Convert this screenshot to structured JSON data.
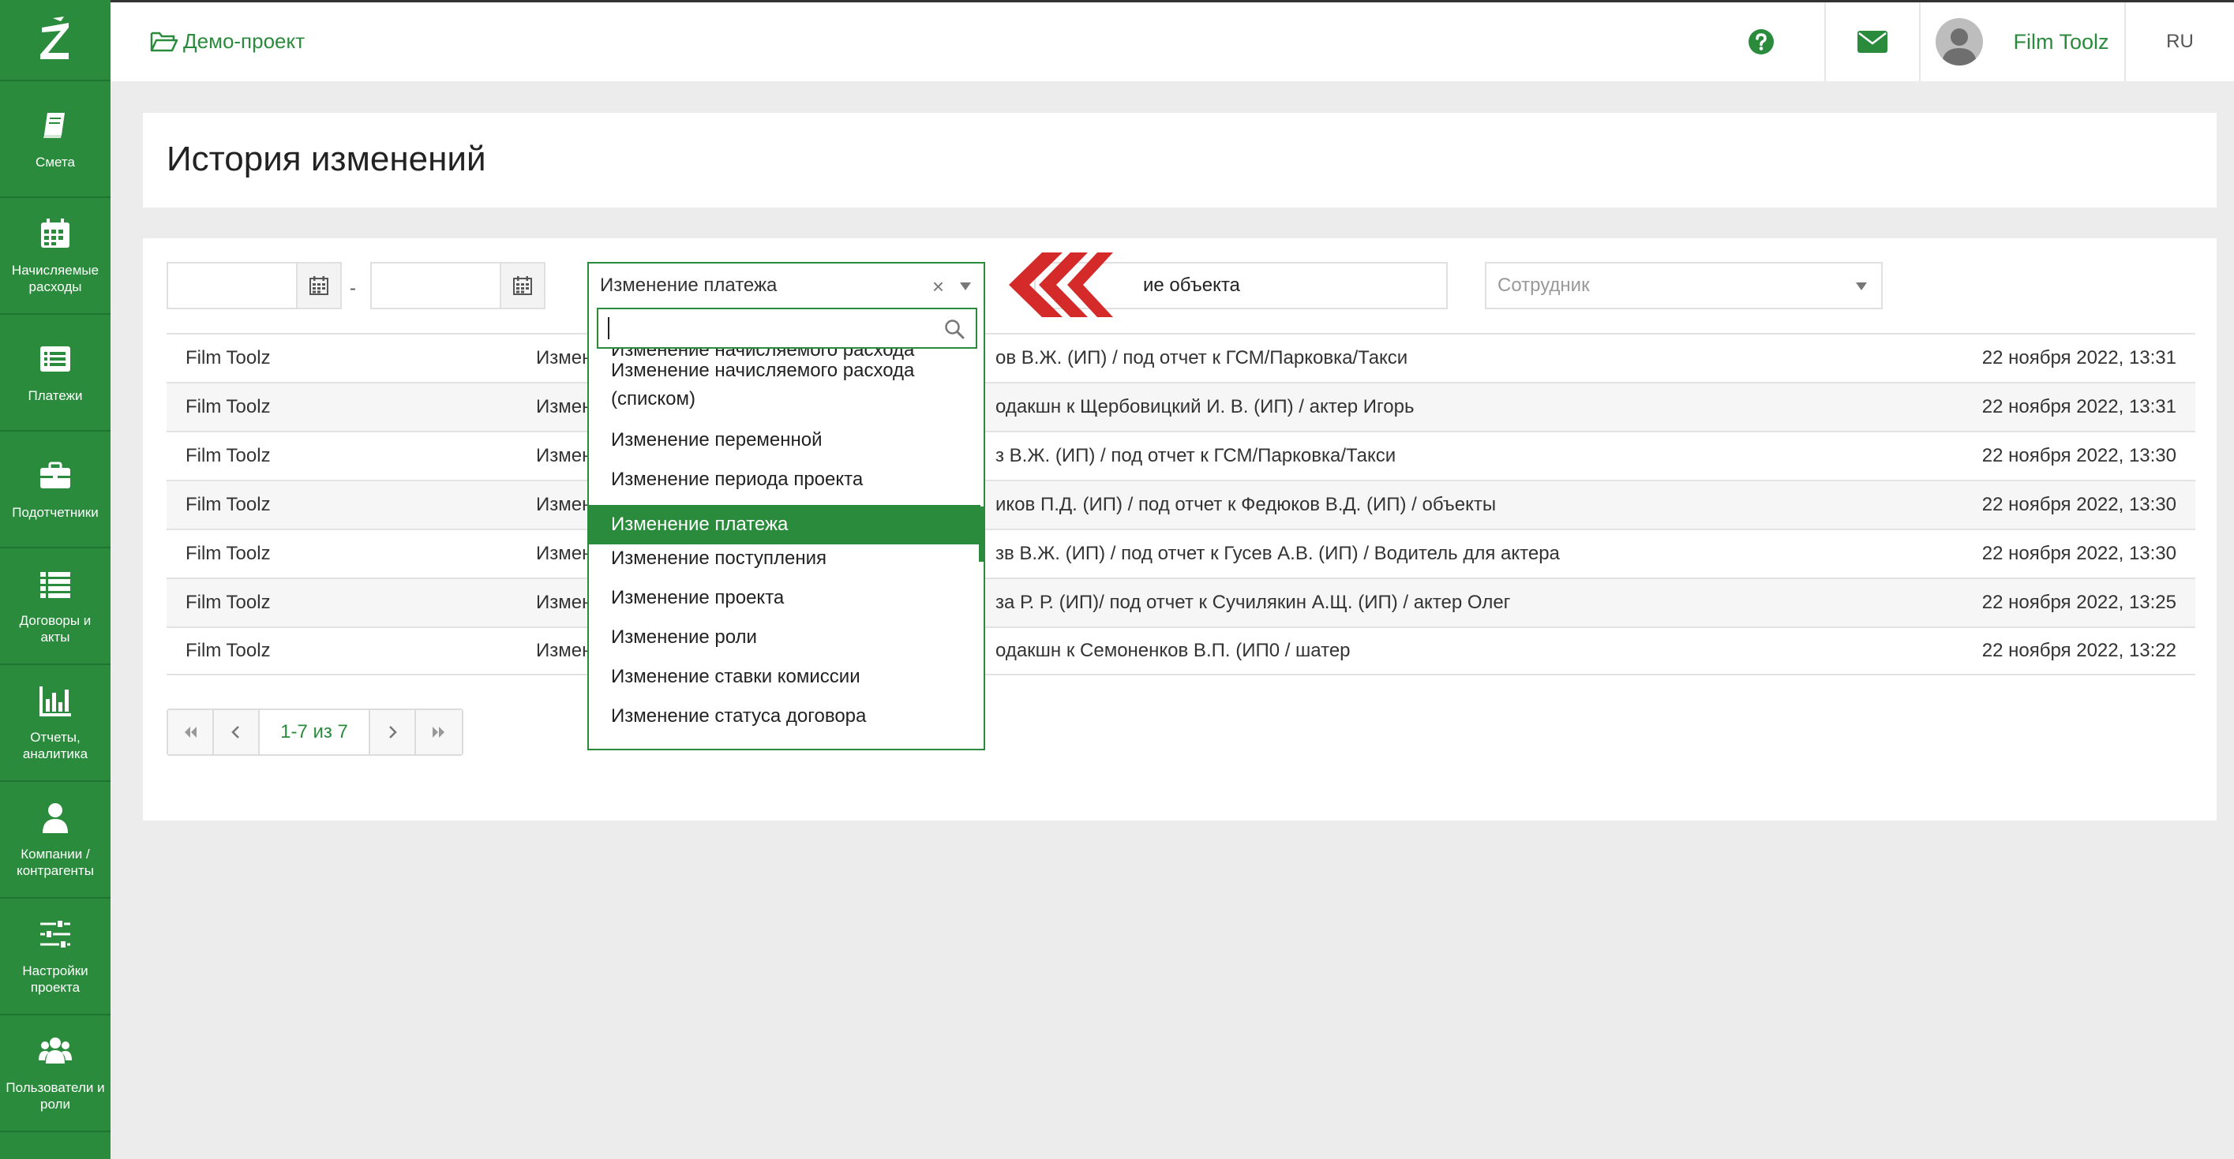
{
  "app": {
    "logo_icon": "z-logo-icon",
    "brand_color": "#2a8b3c"
  },
  "sidebar": {
    "items": [
      {
        "label": "Смета",
        "icon": "book-icon"
      },
      {
        "label": "Начисляемые\nрасходы",
        "icon": "calendar-icon"
      },
      {
        "label": "Платежи",
        "icon": "list-alt-icon"
      },
      {
        "label": "Подотчетники",
        "icon": "briefcase-icon"
      },
      {
        "label": "Договоры и\nакты",
        "icon": "list-icon"
      },
      {
        "label": "Отчеты,\nаналитика",
        "icon": "bar-chart-icon"
      },
      {
        "label": "Компании /\nконтрагенты",
        "icon": "user-icon"
      },
      {
        "label": "Настройки\nпроекта",
        "icon": "sliders-icon"
      },
      {
        "label": "Пользователи и\nроли",
        "icon": "users-icon"
      }
    ]
  },
  "header": {
    "project": "Демо-проект",
    "user_name": "Film Toolz",
    "lang": "RU"
  },
  "page": {
    "title": "История изменений"
  },
  "filters": {
    "date_from": "",
    "date_to": "",
    "date_separator": "-",
    "type_selected": "Изменение платежа",
    "clear_symbol": "×",
    "object_value": "ие объекта",
    "employee_placeholder": "Сотрудник"
  },
  "dropdown": {
    "search_value": "",
    "cut_item": "Изменение начисляемого расхода",
    "items": [
      "Изменение начисляемого расхода (списком)",
      "Изменение переменной",
      "Изменение периода проекта",
      "Изменение платежа",
      "Изменение поступления",
      "Изменение проекта",
      "Изменение роли",
      "Изменение ставки комиссии",
      "Изменение статуса договора"
    ],
    "selected_index": 3
  },
  "table": {
    "rows": [
      {
        "user": "Film Toolz",
        "type": "Измен",
        "desc": "ов В.Ж. (ИП) / под отчет к ГСМ/Парковка/Такси",
        "date": "22 ноября 2022, 13:31"
      },
      {
        "user": "Film Toolz",
        "type": "Измен",
        "desc": "одакшн к Щербовицкий И. В. (ИП) / актер Игорь",
        "date": "22 ноября 2022, 13:31"
      },
      {
        "user": "Film Toolz",
        "type": "Измен",
        "desc": "з В.Ж. (ИП) / под отчет к ГСМ/Парковка/Такси",
        "date": "22 ноября 2022, 13:30"
      },
      {
        "user": "Film Toolz",
        "type": "Измен",
        "desc": "иков П.Д. (ИП) / под отчет к Федюков В.Д. (ИП) / объекты",
        "date": "22 ноября 2022, 13:30"
      },
      {
        "user": "Film Toolz",
        "type": "Измен",
        "desc": "зв В.Ж. (ИП) / под отчет к Гусев А.В. (ИП) / Водитель для актера",
        "date": "22 ноября 2022, 13:30"
      },
      {
        "user": "Film Toolz",
        "type": "Измен",
        "desc": "за Р. Р. (ИП)/ под отчет к Сучилякин А.Щ. (ИП) / актер Олег",
        "date": "22 ноября 2022, 13:25"
      },
      {
        "user": "Film Toolz",
        "type": "Измен",
        "desc": "одакшн к Семоненков В.П. (ИП0 / шатер",
        "date": "22 ноября 2022, 13:22"
      }
    ]
  },
  "pager": {
    "info": "1-7 из 7"
  }
}
